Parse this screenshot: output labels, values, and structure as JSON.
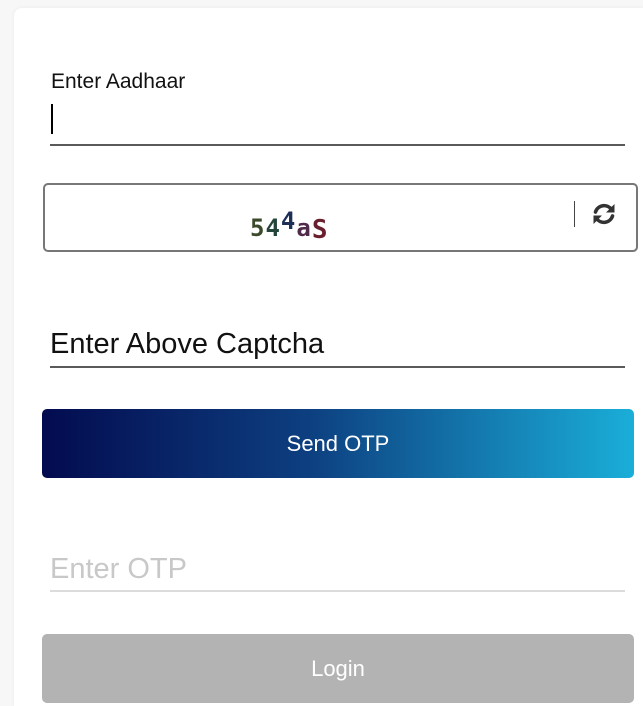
{
  "aadhaar": {
    "label": "Enter Aadhaar",
    "value": ""
  },
  "captcha": {
    "characters": [
      "5",
      "4",
      "4",
      "a",
      "S"
    ],
    "refresh_icon": "refresh-icon"
  },
  "captcha_input": {
    "placeholder": "Enter Above Captcha",
    "value": ""
  },
  "send_otp": {
    "label": "Send OTP",
    "gradient_start": "#030b4f",
    "gradient_end": "#1aaed8"
  },
  "otp_input": {
    "placeholder": "Enter OTP",
    "value": ""
  },
  "login": {
    "label": "Login",
    "color": "#b3b3b3",
    "disabled": true
  }
}
